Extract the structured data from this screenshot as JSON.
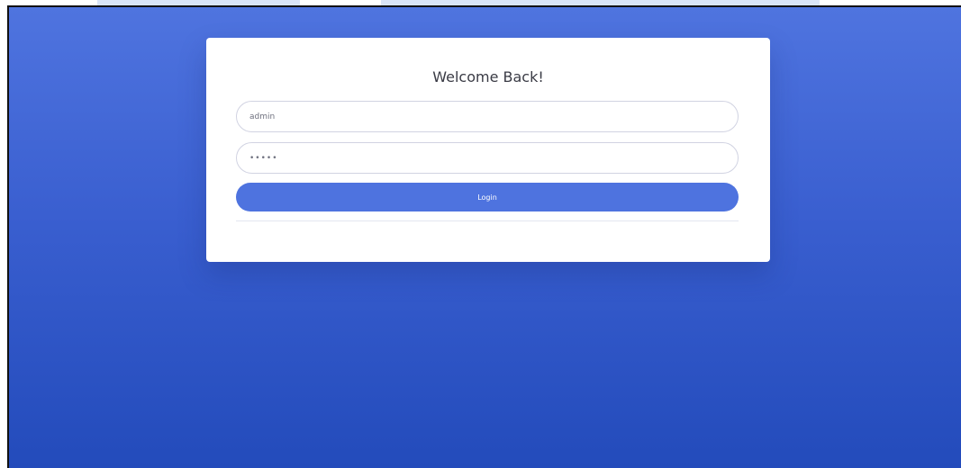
{
  "login": {
    "title": "Welcome Back!",
    "username_value": "admin",
    "password_value": "•••••",
    "button_label": "Login"
  },
  "colors": {
    "primary": "#4e73df",
    "background_top": "#4f74df",
    "background_bottom": "#234bbb",
    "card": "#ffffff"
  }
}
